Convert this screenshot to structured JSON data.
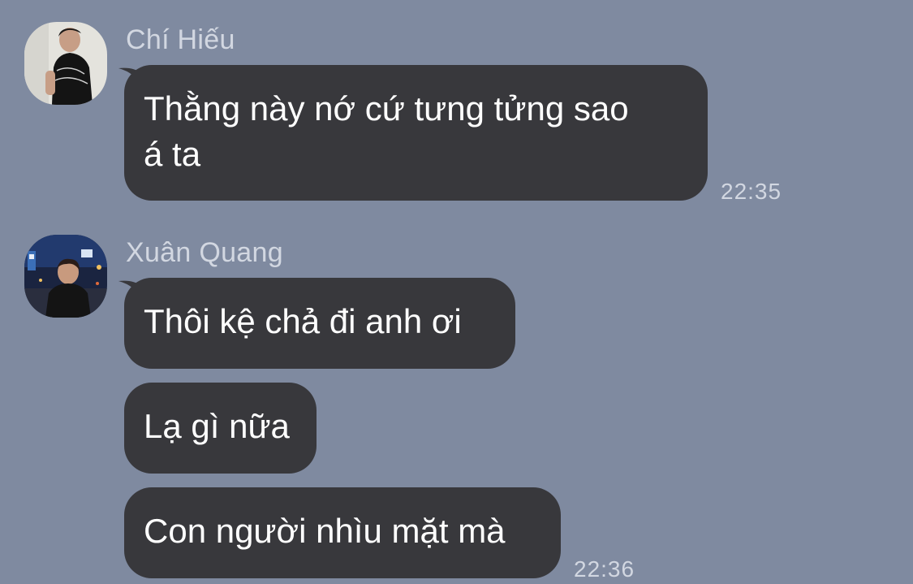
{
  "chat": {
    "groups": [
      {
        "sender": "Chí Hiếu",
        "avatar_icon": "user-avatar-icon",
        "messages": [
          {
            "lines": [
              "Thằng này nớ cứ tưng tửng sao",
              "á ta"
            ],
            "time": "22:35"
          }
        ]
      },
      {
        "sender": "Xuân Quang",
        "avatar_icon": "user-avatar-icon",
        "messages": [
          {
            "lines": [
              "Thôi kệ chả đi anh ơi"
            ]
          },
          {
            "lines": [
              "Lạ gì nữa"
            ]
          },
          {
            "lines": [
              "Con người nhìu mặt mà"
            ],
            "time": "22:36"
          }
        ]
      }
    ]
  },
  "colors": {
    "background": "#7f8aa0",
    "bubble": "#38383c",
    "bubble_text": "#ffffff",
    "meta_text": "#d2d7e1"
  }
}
